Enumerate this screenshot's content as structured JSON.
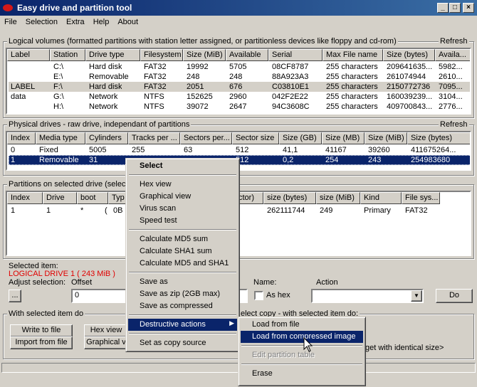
{
  "window": {
    "title": "Easy drive and partition tool"
  },
  "menubar": [
    "File",
    "Selection",
    "Extra",
    "Help",
    "About"
  ],
  "logical": {
    "label": "Logical volumes (formatted partitions with station letter assigned, or partitionless devices like floppy and cd-rom)",
    "refresh": "Refresh",
    "columns": [
      "Label",
      "Station",
      "Drive type",
      "Filesystem",
      "Size (MiB)",
      "Available",
      "Serial",
      "Max File name",
      "Size (bytes)",
      "Availa..."
    ],
    "rows": [
      [
        "",
        "C:\\",
        "Hard disk",
        "FAT32",
        "19992",
        "5705",
        "08CF8787",
        "255 characters",
        "209641635...",
        "5982..."
      ],
      [
        "",
        "E:\\",
        "Removable",
        "FAT32",
        "248",
        "248",
        "88A923A3",
        "255 characters",
        "261074944",
        "2610..."
      ],
      [
        "LABEL",
        "F:\\",
        "Hard disk",
        "FAT32",
        "2051",
        "676",
        "C03810E1",
        "255 characters",
        "2150772736",
        "7095..."
      ],
      [
        "data",
        "G:\\",
        "Network",
        "NTFS",
        "152625",
        "2960",
        "042F2E22",
        "255 characters",
        "160039239...",
        "3104..."
      ],
      [
        "",
        "H:\\",
        "Network",
        "NTFS",
        "39072",
        "2647",
        "94C3608C",
        "255 characters",
        "409700843...",
        "2776..."
      ]
    ]
  },
  "physical": {
    "label": "Physical drives - raw drive, independant of partitions",
    "refresh": "Refresh",
    "columns": [
      "Index",
      "Media type",
      "Cylinders",
      "Tracks per ...",
      "Sectors per...",
      "Sector size",
      "Size (GB)",
      "Size (MB)",
      "Size (MiB)",
      "Size (bytes)"
    ],
    "rows": [
      [
        "0",
        "Fixed",
        "5005",
        "255",
        "63",
        "512",
        "41,1",
        "41167",
        "39260",
        "411675264..."
      ],
      [
        "1",
        "Removable",
        "31",
        "",
        "",
        "512",
        "0,2",
        "254",
        "243",
        "254983680"
      ]
    ]
  },
  "partitions": {
    "label": "Partitions on selected drive (select",
    "columns": [
      "Index",
      "Drive",
      "boot",
      "Typ",
      "ctor)",
      "size (bytes)",
      "size (MiB)",
      "Kind",
      "File sys..."
    ],
    "row": [
      "1",
      "1",
      "*",
      "(",
      "0B",
      "262111744",
      "249",
      "Primary",
      "FAT32"
    ]
  },
  "selected": {
    "label": "Selected item:",
    "value": "LOGICAL DRIVE 1  ( 243 MiB )",
    "adjust_label": "Adjust selection:",
    "offset_label": "Offset",
    "dots": "...",
    "offset_value": "0",
    "name_label": "Name:",
    "ashex_label": "As hex",
    "action_label": "Action",
    "do_label": "Do"
  },
  "withsel": {
    "label": "With selected item do",
    "write": "Write to file",
    "import": "Import from file",
    "hexview": "Hex view",
    "graphical": "Graphical v",
    "selcopy": "elect copy - with selected item do:",
    "identical": "get with identical size>"
  },
  "contextmenu": {
    "items": [
      "Select",
      "Hex view",
      "Graphical view",
      "Virus scan",
      "Speed test",
      "Calculate MD5 sum",
      "Calculate SHA1 sum",
      "Calculate MD5 and SHA1",
      "Save as",
      "Save as zip (2GB max)",
      "Save as compressed",
      "Destructive actions",
      "Set as copy source"
    ]
  },
  "submenu": {
    "items": [
      "Load from file",
      "Load from compressed image",
      "Edit partition table",
      "Erase"
    ]
  }
}
